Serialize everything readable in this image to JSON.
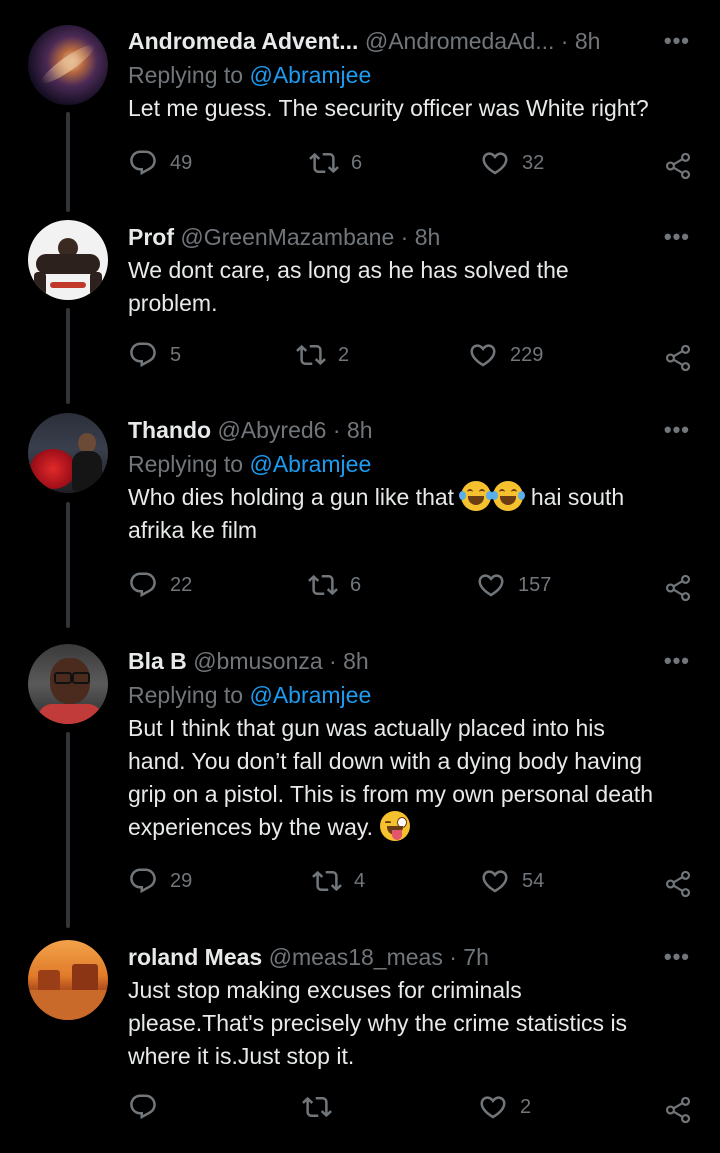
{
  "tweets": [
    {
      "name": "Andromeda Advent...",
      "handle": "@AndromedaAd...",
      "time": "8h",
      "replying_label": "Replying to",
      "replying_to": "@Abramjee",
      "text": "Let me guess. The security officer was White right?",
      "replies": "49",
      "retweets": "6",
      "likes": "32"
    },
    {
      "name": "Prof",
      "handle": "@GreenMazambane",
      "time": "8h",
      "text_line1": "We dont care, as long as he has solved the",
      "text_line2": "problem.",
      "replies": "5",
      "retweets": "2",
      "likes": "229"
    },
    {
      "name": "Thando",
      "handle": "@Abyred6",
      "time": "8h",
      "replying_label": "Replying to",
      "replying_to": "@Abramjee",
      "text_part1": "Who dies holding a gun like that",
      "emoji": "😂😂",
      "text_part2": "hai south",
      "text_line2": "afrika ke film",
      "replies": "22",
      "retweets": "6",
      "likes": "157"
    },
    {
      "name": "Bla B",
      "handle": "@bmusonza",
      "time": "8h",
      "replying_label": "Replying to",
      "replying_to": "@Abramjee",
      "text_line1": "But I think that gun was actually placed into his",
      "text_line2": "hand. You don’t fall down with a dying body having",
      "text_line3": "grip on a pistol. This is from my own personal death",
      "text_line4": "experiences by the way.",
      "emoji": "😜",
      "replies": "29",
      "retweets": "4",
      "likes": "54"
    },
    {
      "name": "roland Meas",
      "handle": "@meas18_meas",
      "time": "7h",
      "text_line1": "Just stop making excuses for criminals",
      "text_line2": "please.That's precisely why the crime statistics is",
      "text_line3": "where it is.Just stop it.",
      "likes": "2"
    }
  ],
  "separator_dot": "·",
  "more_icon": "more-horizontal-icon",
  "colors": {
    "background": "#000000",
    "text": "#e7e9ea",
    "muted": "#71767b",
    "link": "#1d9bf0"
  }
}
